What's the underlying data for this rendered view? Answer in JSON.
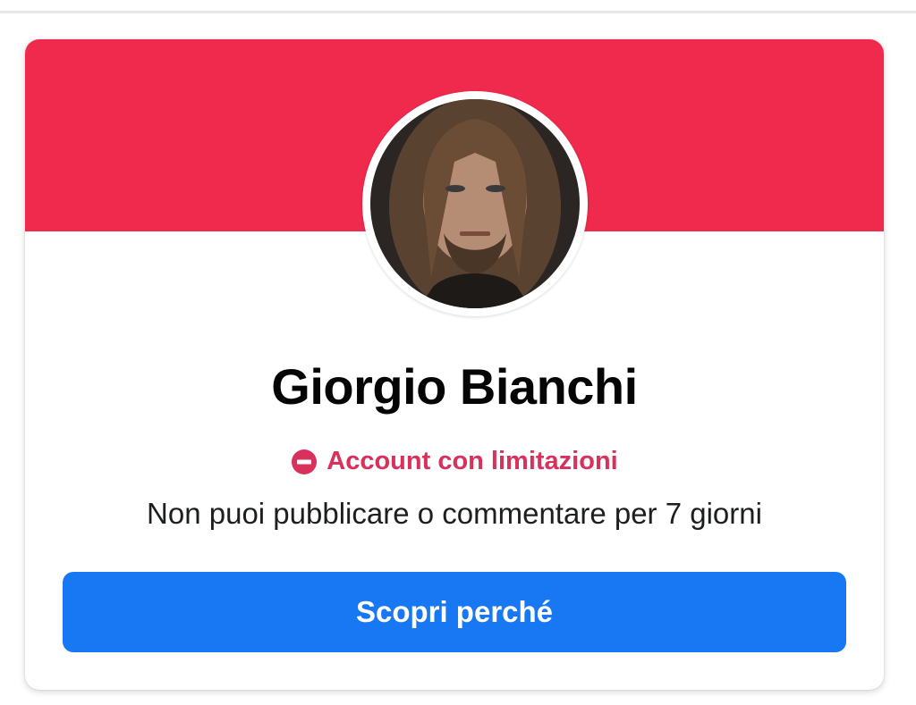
{
  "colors": {
    "banner": "#ef2a4d",
    "status_red": "#d8325c",
    "button_blue": "#1877f2"
  },
  "profile": {
    "name": "Giorgio Bianchi",
    "status_icon": "minus-circle-icon",
    "status_label": "Account con limitazioni",
    "description": "Non puoi pubblicare o commentare per 7 giorni"
  },
  "actions": {
    "learn_why_label": "Scopri perché"
  }
}
